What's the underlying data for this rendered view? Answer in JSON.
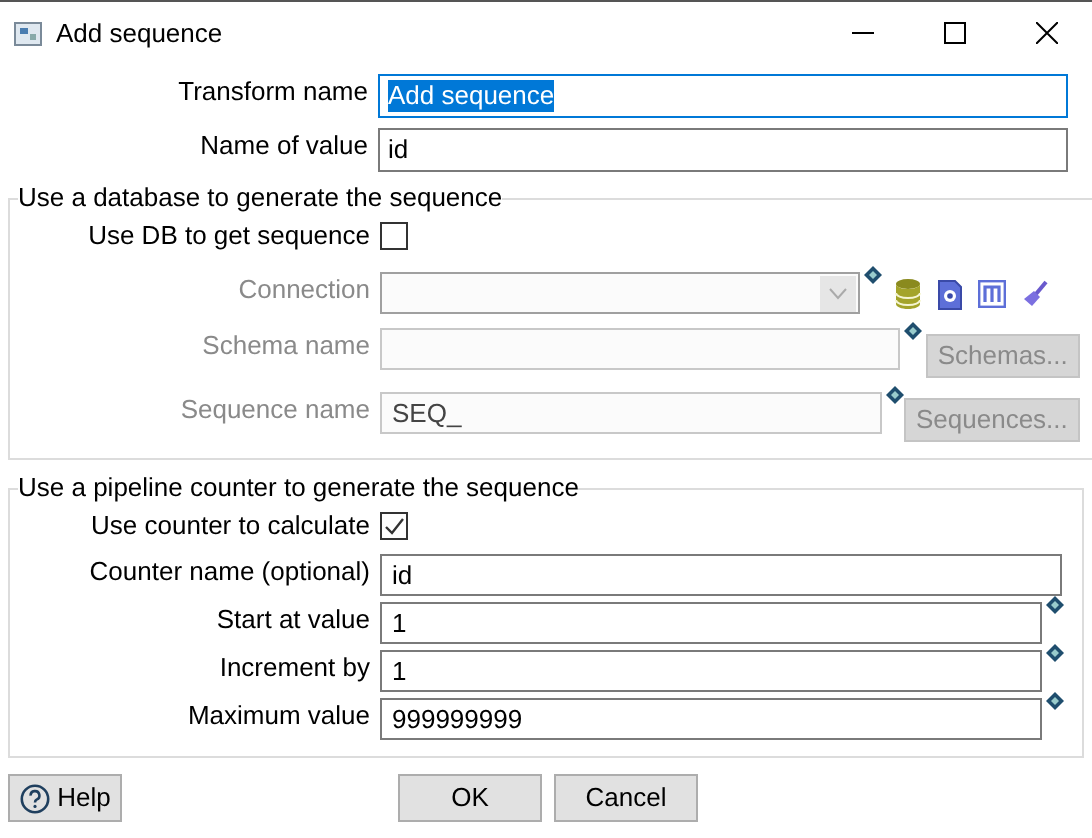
{
  "window": {
    "title": "Add sequence"
  },
  "fields": [
    {
      "label": "Transform name",
      "value": "Add sequence",
      "focused": true
    },
    {
      "label": "Name of value",
      "value": "id",
      "focused": false
    }
  ],
  "database_group": {
    "title": "Use a database to generate the sequence",
    "checkbox": {
      "label": "Use DB to get sequence",
      "checked": false
    },
    "rows": [
      {
        "kind": "dropdown",
        "label": "Connection",
        "disabled": true,
        "variable": true
      },
      {
        "kind": "text_with_button",
        "label": "Schema name",
        "disabled": true,
        "variable": true,
        "button": "Schemas..."
      },
      {
        "kind": "text_with_button",
        "label": "Sequence name",
        "value": "SEQ_",
        "disabled": true,
        "variable": true,
        "button": "Sequences..."
      }
    ]
  },
  "counter_group": {
    "title": "Use a pipeline counter to generate the sequence",
    "checkbox": {
      "label": "Use counter to calculate",
      "checked": true
    },
    "rows": [
      {
        "kind": "text",
        "label": "Counter name (optional)",
        "value": "id",
        "disabled": false,
        "variable": false
      },
      {
        "kind": "text",
        "label": "Start at value",
        "value": "1",
        "disabled": false,
        "variable": true
      },
      {
        "kind": "text",
        "label": "Increment by",
        "value": "1",
        "disabled": false,
        "variable": true
      },
      {
        "kind": "text",
        "label": "Maximum value",
        "value": "999999999",
        "disabled": false,
        "variable": true
      }
    ]
  },
  "buttons": [
    {
      "kind": "help",
      "label": "Help"
    },
    {
      "kind": "ok",
      "label": "OK"
    },
    {
      "kind": "cancel",
      "label": "Cancel"
    }
  ]
}
